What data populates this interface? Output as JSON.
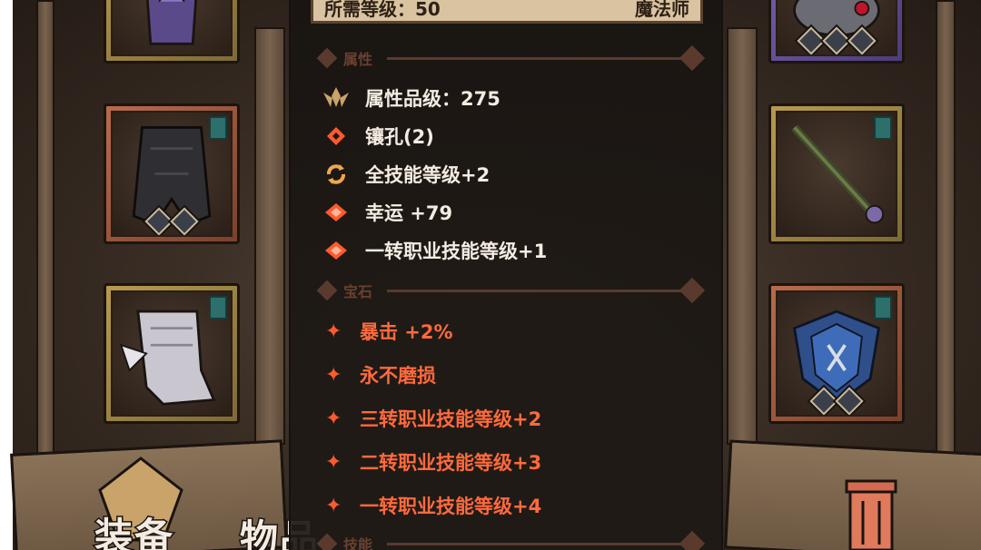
{
  "tooltip": {
    "required_level_label": "所需等级：50",
    "class_label": "魔法师",
    "sections": {
      "attributes": "属性",
      "gems": "宝石",
      "skills": "技能"
    },
    "attributes": [
      {
        "icon": "lotus-icon",
        "text": "属性品级：275"
      },
      {
        "icon": "socket-icon",
        "text": "镶孔(2)"
      },
      {
        "icon": "cycle-icon",
        "text": "全技能等级+2"
      },
      {
        "icon": "luck-icon",
        "text": "幸运 +79"
      },
      {
        "icon": "luck-icon",
        "text": "一转职业技能等级+1"
      }
    ],
    "gem_attributes": [
      "暴击 +2%",
      "永不磨损",
      "三转职业技能等级+2",
      "二转职业技能等级+3",
      "一转职业技能等级+4"
    ]
  },
  "tabs": {
    "equipment": "装备",
    "items": "物品"
  },
  "colors": {
    "gem_text": "#ff6a3d",
    "attr_text": "#f4ece2",
    "section_label": "#6a4030",
    "req_bar_bg": "#d9c3a1"
  }
}
